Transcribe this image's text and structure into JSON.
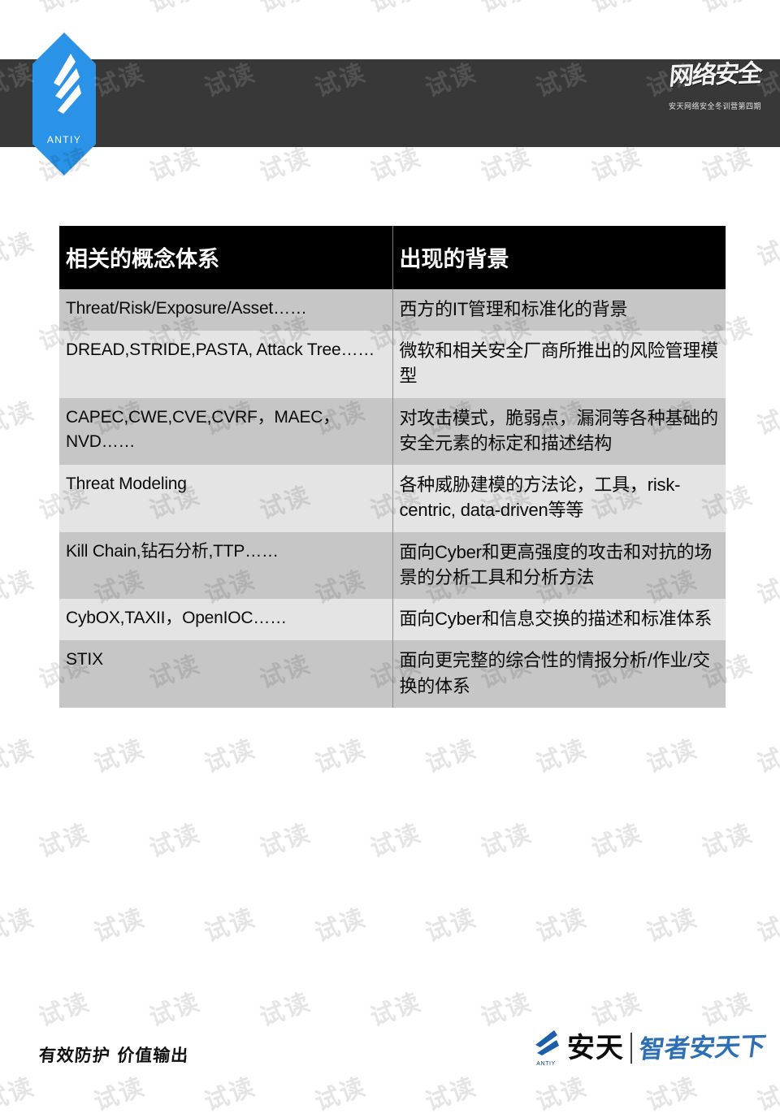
{
  "header": {
    "brand_wordmark": "ANTIY",
    "logo_icon": "antiy-feather-icon",
    "calligraphy_title": "网络安全",
    "calligraphy_subtitle": "安天网络安全冬训营第四期",
    "band_color": "#383838",
    "badge_color": "#2a93e8"
  },
  "watermark": {
    "text": "试读"
  },
  "table": {
    "columns": [
      "相关的概念体系",
      "出现的背景"
    ],
    "rows": [
      {
        "concept": "Threat/Risk/Exposure/Asset……",
        "background": "西方的IT管理和标准化的背景"
      },
      {
        "concept": "DREAD,STRIDE,PASTA, Attack Tree……",
        "background": "微软和相关安全厂商所推出的风险管理模型"
      },
      {
        "concept": "CAPEC,CWE,CVE,CVRF，MAEC，NVD……",
        "background": "对攻击模式，脆弱点，漏洞等各种基础的安全元素的标定和描述结构"
      },
      {
        "concept": "Threat Modeling",
        "background": "各种威胁建模的方法论，工具，risk-centric, data-driven等等"
      },
      {
        "concept": "Kill Chain,钻石分析,TTP……",
        "background": "面向Cyber和更高强度的攻击和对抗的场景的分析工具和分析方法"
      },
      {
        "concept": "CybOX,TAXII，OpenIOC……",
        "background": "面向Cyber和信息交换的描述和标准体系"
      },
      {
        "concept": "STIX",
        "background": "面向更完整的综合性的情报分析/作业/交换的体系"
      }
    ]
  },
  "footer": {
    "slogan": "有效防护 价值输出",
    "brand_wordmark": "ANTIY",
    "brand_cn": "安天",
    "tagline": "智者安天下",
    "tagline_color": "#2d6fb5"
  }
}
